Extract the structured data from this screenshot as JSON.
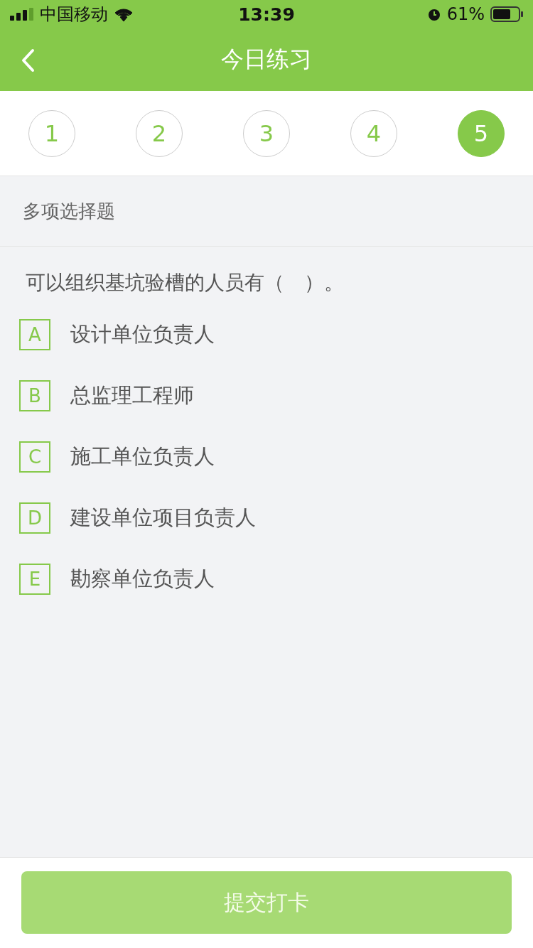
{
  "status_bar": {
    "carrier": "中国移动",
    "time": "13:39",
    "battery": "61%"
  },
  "nav_bar": {
    "title": "今日练习"
  },
  "steps": [
    {
      "label": "1",
      "selected": false
    },
    {
      "label": "2",
      "selected": false
    },
    {
      "label": "3",
      "selected": false
    },
    {
      "label": "4",
      "selected": false
    },
    {
      "label": "5",
      "selected": true
    }
  ],
  "question": {
    "type": "多项选择题",
    "text": "可以组织基坑验槽的人员有（　）。",
    "options": [
      {
        "letter": "A",
        "text": "设计单位负责人",
        "selected": false
      },
      {
        "letter": "B",
        "text": "总监理工程师",
        "selected": false
      },
      {
        "letter": "C",
        "text": "施工单位负责人",
        "selected": false
      },
      {
        "letter": "D",
        "text": "建设单位项目负责人",
        "selected": false
      },
      {
        "letter": "E",
        "text": "勘察单位负责人",
        "selected": false
      }
    ]
  },
  "submit_button": {
    "label": "提交打卡",
    "disabled": true
  }
}
